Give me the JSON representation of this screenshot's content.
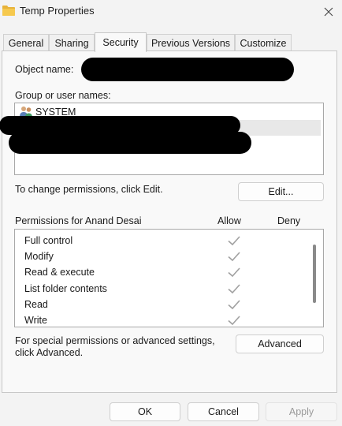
{
  "window": {
    "title": "Temp Properties",
    "close_icon": "close-icon",
    "folder_icon": "folder-icon"
  },
  "tabs": [
    {
      "label": "General",
      "active": false
    },
    {
      "label": "Sharing",
      "active": false
    },
    {
      "label": "Security",
      "active": true
    },
    {
      "label": "Previous Versions",
      "active": false
    },
    {
      "label": "Customize",
      "active": false
    }
  ],
  "security": {
    "object_name_label": "Object name:",
    "group_label": "Group or user names:",
    "users": [
      {
        "name": "SYSTEM",
        "icon": "users-icon"
      }
    ],
    "change_hint": "To change permissions, click Edit.",
    "edit_button": "Edit...",
    "permissions_for": "Permissions for Anand Desai",
    "allow_header": "Allow",
    "deny_header": "Deny",
    "permissions": [
      {
        "name": "Full control",
        "allow": true,
        "deny": false
      },
      {
        "name": "Modify",
        "allow": true,
        "deny": false
      },
      {
        "name": "Read & execute",
        "allow": true,
        "deny": false
      },
      {
        "name": "List folder contents",
        "allow": true,
        "deny": false
      },
      {
        "name": "Read",
        "allow": true,
        "deny": false
      },
      {
        "name": "Write",
        "allow": true,
        "deny": false
      }
    ],
    "special_hint_line1": "For special permissions or advanced settings,",
    "special_hint_line2": "click Advanced.",
    "advanced_button": "Advanced"
  },
  "footer": {
    "ok": "OK",
    "cancel": "Cancel",
    "apply": "Apply",
    "apply_disabled": true
  },
  "colors": {
    "window_bg": "#f3f3f3",
    "panel_bg": "#f9f9f9",
    "check_gray": "#a0a0a0",
    "redaction": "#000000"
  }
}
